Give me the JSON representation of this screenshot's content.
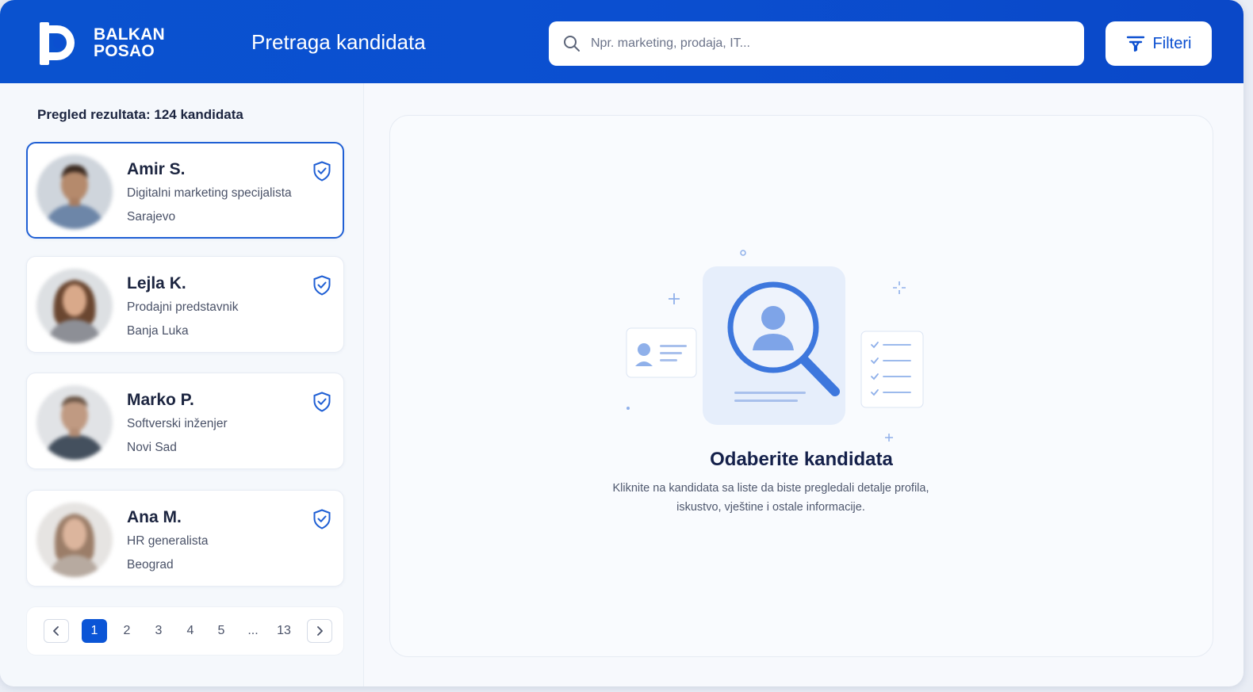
{
  "header": {
    "brand_line1": "BALKAN",
    "brand_line2": "POSAO",
    "title": "Pretraga kandidata",
    "search_placeholder": "Npr. marketing, prodaja, IT...",
    "filter_label": "Filteri"
  },
  "results": {
    "summary": "Pregled rezultata: 124 kandidata",
    "candidates": [
      {
        "name": "Amir S.",
        "role": "Digitalni marketing specijalista",
        "city": "Sarajevo",
        "selected": true
      },
      {
        "name": "Lejla K.",
        "role": "Prodajni predstavnik",
        "city": "Banja Luka",
        "selected": false
      },
      {
        "name": "Marko P.",
        "role": "Softverski inženjer",
        "city": "Novi Sad",
        "selected": false
      },
      {
        "name": "Ana M.",
        "role": "HR generalista",
        "city": "Beograd",
        "selected": false
      }
    ]
  },
  "pagination": {
    "pages": [
      "1",
      "2",
      "3",
      "4",
      "5",
      "...",
      "13"
    ],
    "current": "1"
  },
  "detail": {
    "empty_title": "Odaberite kandidata",
    "empty_line1": "Kliknite na kandidata sa liste da biste pregledali detalje profila,",
    "empty_line2": "iskustvo, vještine i ostale informacije."
  },
  "colors": {
    "brand_blue": "#0b4fd0",
    "accent_light": "#8fb0ea"
  }
}
